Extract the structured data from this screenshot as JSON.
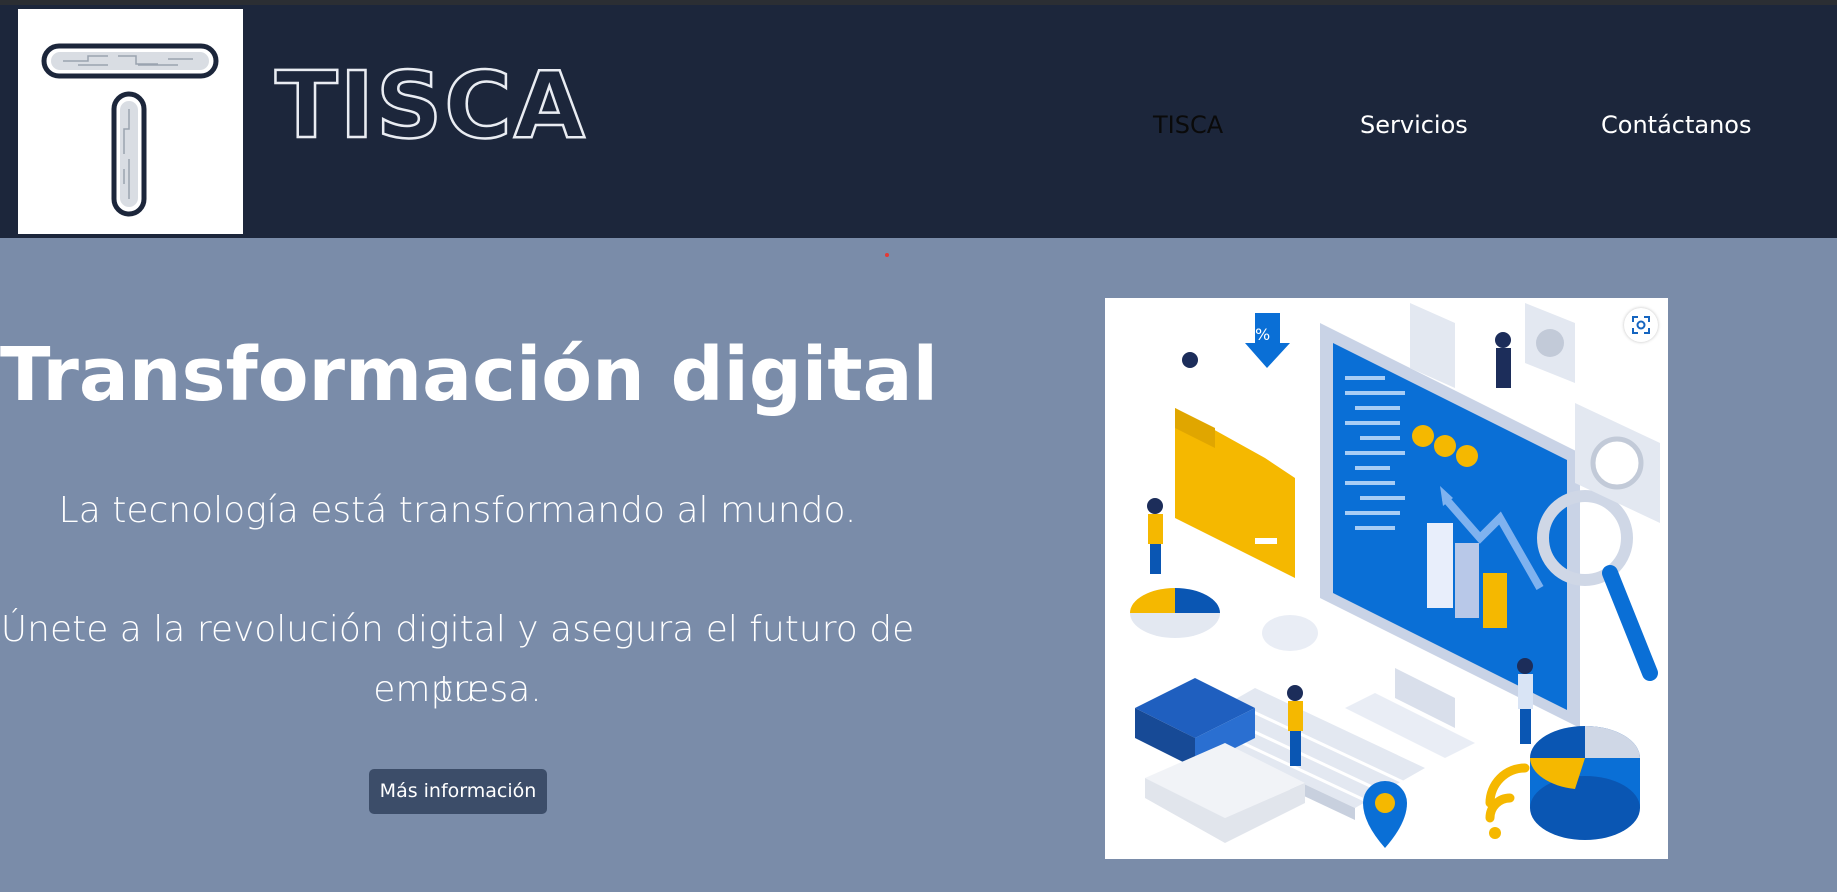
{
  "header": {
    "brand": "TISCA",
    "nav": [
      {
        "label": "TISCA",
        "color": "#0a0a0a"
      },
      {
        "label": "Servicios",
        "color": "#ffffff"
      },
      {
        "label": "Contáctanos",
        "color": "#ffffff"
      }
    ]
  },
  "hero": {
    "title": "Transformación digital",
    "subtitle": "La tecnología está transformando al mundo.",
    "body_line1": "Únete a la revolución digital y asegura el futuro de tu",
    "body_line2": "empresa.",
    "cta_label": "Más información"
  },
  "colors": {
    "navbar": "#1c263b",
    "hero_background": "#7a8ca9",
    "button": "#3c4d69",
    "illustration_blue": "#0a6fd6",
    "illustration_yellow": "#f5b800"
  },
  "icons": [
    "logo-t-icon",
    "visual-search-icon"
  ]
}
